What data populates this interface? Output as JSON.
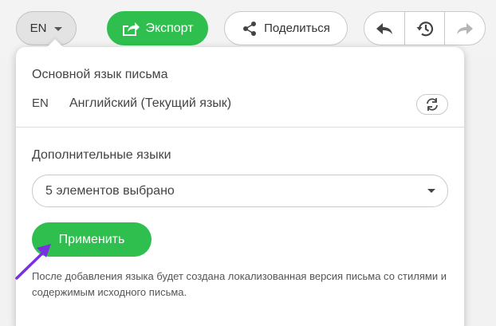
{
  "toolbar": {
    "lang_button": "EN",
    "export_label": "Экспорт",
    "share_label": "Поделиться"
  },
  "popup": {
    "main_lang_title": "Основной язык письма",
    "main_lang_code": "EN",
    "main_lang_name": "Английский (Текущий язык)",
    "extra_lang_title": "Дополнительные языки",
    "extra_lang_value": "5 элементов выбрано",
    "apply_label": "Применить",
    "note": "После добавления языка будет создана локализованная версия письма со стилями и содержимым исходного письма."
  },
  "colors": {
    "accent_green": "#2fbf4f",
    "pointer_purple": "#7a2fe0"
  },
  "icons": {
    "export": "export-icon",
    "share": "share-icon",
    "undo": "undo-icon",
    "history": "history-icon",
    "redo": "redo-icon",
    "sync": "sync-icon",
    "pointer": "pointer-arrow-icon"
  }
}
